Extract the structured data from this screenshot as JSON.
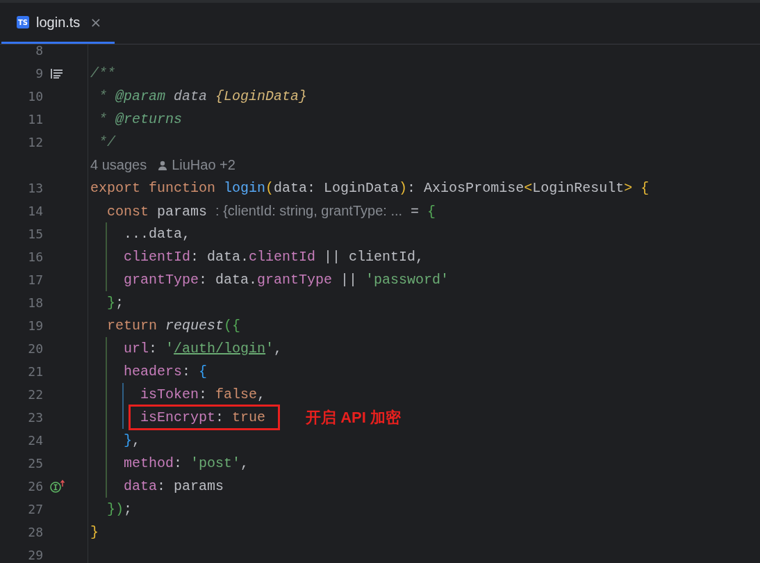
{
  "tabs": [
    {
      "badge": "TS",
      "label": "login.ts",
      "close": "×",
      "selected": true
    }
  ],
  "lines": [
    {
      "kind": "code",
      "number": "8",
      "highlighted": false
    },
    {
      "kind": "code",
      "number": "9",
      "highlighted": false,
      "gutter": {
        "kind": "doc"
      },
      "tokens": [
        {
          "text": "/**",
          "kind": "comment"
        }
      ]
    },
    {
      "kind": "code",
      "number": "10",
      "highlighted": false,
      "tokens": [
        {
          "text": " * ",
          "kind": "comment"
        },
        {
          "text": "@param",
          "kind": "doctag"
        },
        {
          "text": " data ",
          "kind": "docvalue"
        },
        {
          "text": "{LoginData}",
          "kind": "doctype"
        }
      ]
    },
    {
      "kind": "code",
      "number": "11",
      "highlighted": false,
      "tokens": [
        {
          "text": " * ",
          "kind": "comment"
        },
        {
          "text": "@returns",
          "kind": "doctag"
        }
      ]
    },
    {
      "kind": "code",
      "number": "12",
      "highlighted": false,
      "tokens": [
        {
          "text": " */",
          "kind": "comment"
        }
      ]
    },
    {
      "kind": "inlay",
      "usages": "4 usages",
      "author": "LiuHao +2"
    },
    {
      "kind": "code",
      "number": "13",
      "highlighted": false,
      "tokens": [
        {
          "text": "export function ",
          "kind": "keyword"
        },
        {
          "text": "login",
          "kind": "fn"
        },
        {
          "text": "(",
          "kind": "yellow"
        },
        {
          "text": "data: LoginData",
          "kind": "plain"
        },
        {
          "text": ")",
          "kind": "yellow"
        },
        {
          "text": ": AxiosPromise",
          "kind": "plain"
        },
        {
          "text": "<",
          "kind": "yellow"
        },
        {
          "text": "LoginResult",
          "kind": "plain"
        },
        {
          "text": "> {",
          "kind": "yellow"
        }
      ],
      "children": [
        {
          "kind": "code",
          "number": "14",
          "highlighted": false,
          "tokens": [
            {
              "text": "const ",
              "kind": "keyword"
            },
            {
              "text": "params ",
              "kind": "plain"
            },
            {
              "text": ": {clientId: string, grantType: ...",
              "kind": "hint"
            },
            {
              "text": " = ",
              "kind": "plain"
            },
            {
              "text": "{",
              "kind": "green"
            }
          ],
          "children": [
            {
              "kind": "code",
              "number": "15",
              "highlighted": false,
              "tokens": [
                {
                  "text": "...data,",
                  "kind": "plain"
                }
              ]
            },
            {
              "kind": "code",
              "number": "16",
              "highlighted": false,
              "tokens": [
                {
                  "text": "clientId",
                  "kind": "prop"
                },
                {
                  "text": ": data.",
                  "kind": "plain"
                },
                {
                  "text": "clientId",
                  "kind": "prop"
                },
                {
                  "text": " || clientId,",
                  "kind": "plain"
                }
              ]
            },
            {
              "kind": "code",
              "number": "17",
              "highlighted": false,
              "tokens": [
                {
                  "text": "grantType",
                  "kind": "prop"
                },
                {
                  "text": ": data.",
                  "kind": "plain"
                },
                {
                  "text": "grantType",
                  "kind": "prop"
                },
                {
                  "text": " || ",
                  "kind": "plain"
                },
                {
                  "text": "'password'",
                  "kind": "string"
                }
              ]
            }
          ]
        },
        {
          "kind": "code",
          "number": "18",
          "highlighted": false,
          "tokens": [
            {
              "text": "}",
              "kind": "green"
            },
            {
              "text": ";",
              "kind": "plain"
            }
          ]
        },
        {
          "kind": "code",
          "number": "19",
          "highlighted": false,
          "tokens": [
            {
              "text": "return ",
              "kind": "keyword"
            },
            {
              "text": "request",
              "kind": "call"
            },
            {
              "text": "({",
              "kind": "green"
            }
          ],
          "children": [
            {
              "kind": "code",
              "number": "20",
              "highlighted": false,
              "tokens": [
                {
                  "text": "url",
                  "kind": "prop"
                },
                {
                  "text": ": ",
                  "kind": "plain"
                },
                {
                  "text": "'",
                  "kind": "string"
                },
                {
                  "text": "/auth/login",
                  "kind": "link"
                },
                {
                  "text": "'",
                  "kind": "string"
                },
                {
                  "text": ",",
                  "kind": "plain"
                }
              ]
            },
            {
              "kind": "code",
              "number": "21",
              "highlighted": false,
              "tokens": [
                {
                  "text": "headers",
                  "kind": "prop"
                },
                {
                  "text": ": ",
                  "kind": "plain"
                },
                {
                  "text": "{",
                  "kind": "blue"
                }
              ],
              "children": [
                {
                  "kind": "code",
                  "number": "22",
                  "highlighted": false,
                  "tokens": [
                    {
                      "text": "isToken",
                      "kind": "prop"
                    },
                    {
                      "text": ": ",
                      "kind": "plain"
                    },
                    {
                      "text": "false",
                      "kind": "keyword"
                    },
                    {
                      "text": ",",
                      "kind": "plain"
                    }
                  ]
                },
                {
                  "kind": "code",
                  "number": "23",
                  "highlighted": true,
                  "note": "开启 API 加密",
                  "tokens": [
                    {
                      "text": "isEncrypt",
                      "kind": "prop"
                    },
                    {
                      "text": ": ",
                      "kind": "plain"
                    },
                    {
                      "text": "true",
                      "kind": "keyword"
                    }
                  ]
                }
              ]
            },
            {
              "kind": "code",
              "number": "24",
              "highlighted": false,
              "tokens": [
                {
                  "text": "}",
                  "kind": "blue"
                },
                {
                  "text": ",",
                  "kind": "plain"
                }
              ]
            },
            {
              "kind": "code",
              "number": "25",
              "highlighted": false,
              "tokens": [
                {
                  "text": "method",
                  "kind": "prop"
                },
                {
                  "text": ": ",
                  "kind": "plain"
                },
                {
                  "text": "'post'",
                  "kind": "string"
                },
                {
                  "text": ",",
                  "kind": "plain"
                }
              ]
            },
            {
              "kind": "code",
              "number": "26",
              "highlighted": false,
              "gutter": {
                "kind": "implements"
              },
              "tokens": [
                {
                  "text": "data",
                  "kind": "prop"
                },
                {
                  "text": ": params",
                  "kind": "plain"
                }
              ]
            }
          ]
        },
        {
          "kind": "code",
          "number": "27",
          "highlighted": false,
          "tokens": [
            {
              "text": "})",
              "kind": "green"
            },
            {
              "text": ";",
              "kind": "plain"
            }
          ]
        }
      ]
    },
    {
      "kind": "code",
      "number": "28",
      "highlighted": false,
      "tokens": [
        {
          "text": "}",
          "kind": "yellow"
        }
      ]
    },
    {
      "kind": "code",
      "number": "29",
      "highlighted": false
    }
  ]
}
